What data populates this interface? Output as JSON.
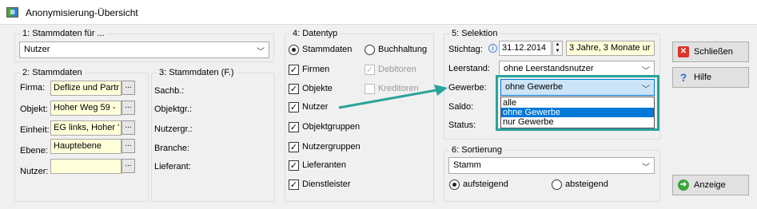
{
  "window": {
    "title": "Anonymisierung-Übersicht",
    "icon": "app-grid-icon"
  },
  "stammdaten_fuer": {
    "legend": "1: Stammdaten für ...",
    "value": "Nutzer"
  },
  "stammdaten": {
    "legend": "2: Stammdaten",
    "fields": [
      {
        "label": "Firma:",
        "value": "Deflize und Partr"
      },
      {
        "label": "Objekt:",
        "value": "Hoher Weg 59 -"
      },
      {
        "label": "Einheit:",
        "value": "EG links, Hoher '"
      },
      {
        "label": "Ebene:",
        "value": "Hauptebene"
      },
      {
        "label": "Nutzer:",
        "value": ""
      }
    ],
    "dots_label": "..."
  },
  "stammdaten_f": {
    "legend": "3: Stammdaten (F.)",
    "labels": [
      "Sachb.:",
      "Objektgr.:",
      "Nutzergr.:",
      "Branche:",
      "Lieferant:"
    ]
  },
  "datentyp": {
    "legend": "4: Datentyp",
    "radio_stammdaten": "Stammdaten",
    "radio_buchhaltung": "Buchhaltung",
    "checks": [
      "Firmen",
      "Objekte",
      "Nutzer",
      "Objektgruppen",
      "Nutzergruppen",
      "Lieferanten",
      "Dienstleister"
    ],
    "disabled_checks": [
      "Debitoren",
      "Kreditoren"
    ]
  },
  "selektion": {
    "legend": "5: Selektion",
    "stichtag_label": "Stichtag:",
    "stichtag_value": "31.12.2014",
    "age_value": "3 Jahre, 3 Monate ur",
    "leerstand_label": "Leerstand:",
    "leerstand_value": "ohne Leerstandsnutzer",
    "gewerbe_label": "Gewerbe:",
    "gewerbe_value": "ohne Gewerbe",
    "gewerbe_options": [
      "alle",
      "ohne Gewerbe",
      "nur Gewerbe"
    ],
    "saldo_label": "Saldo:",
    "status_label": "Status:"
  },
  "sortierung": {
    "legend": "6: Sortierung",
    "value": "Stamm",
    "radio_auf": "aufsteigend",
    "radio_ab": "absteigend"
  },
  "buttons": {
    "schliessen": "Schließen",
    "hilfe": "Hilfe",
    "anzeige": "Anzeige"
  },
  "colors": {
    "highlight_box": "#2aa39a",
    "arrow": "#2aa39a",
    "selection": "#0078d7"
  }
}
